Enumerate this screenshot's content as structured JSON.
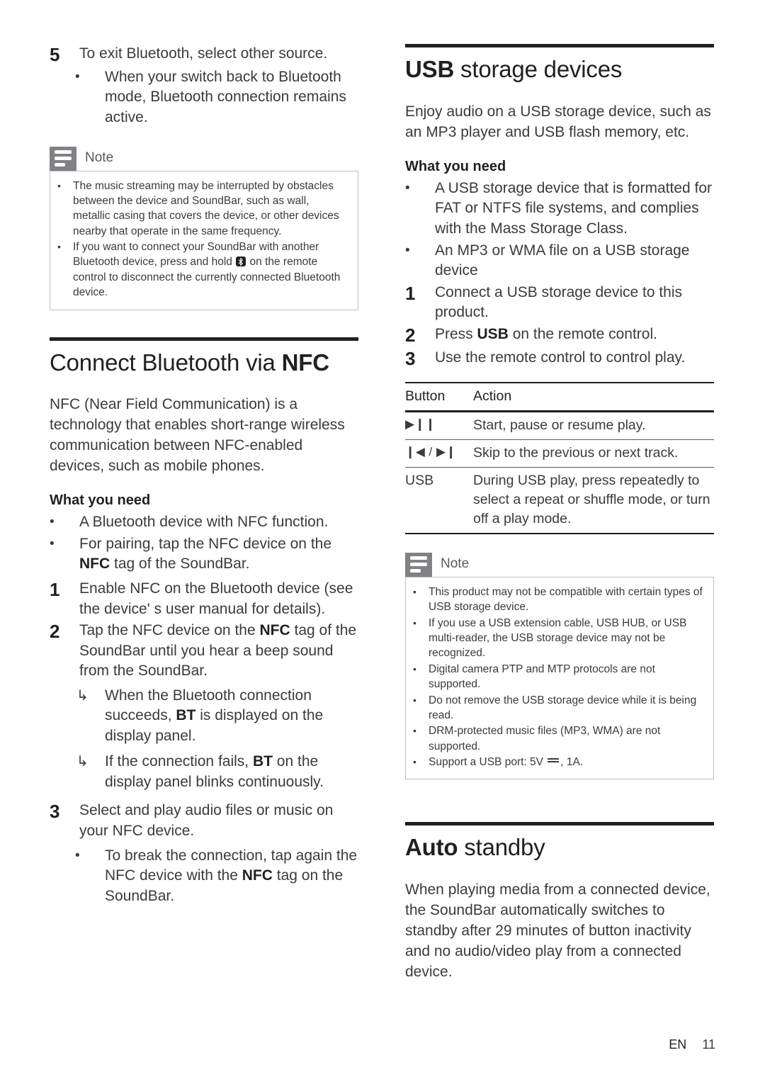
{
  "left_column": {
    "step5": {
      "number": "5",
      "text": "To exit Bluetooth, select other source.",
      "sub_bullets": [
        {
          "marker": "•",
          "text": "When your switch back to Bluetooth mode, Bluetooth connection remains active."
        }
      ]
    },
    "note1": {
      "title": "Note",
      "icon": "note-lines-icon",
      "bullets": [
        {
          "before": "The music streaming may be interrupted by obstacles between the device and SoundBar, such as wall, metallic casing that covers the device, or other devices nearby that operate in the same frequency.",
          "glyph": "",
          "after": ""
        },
        {
          "before": "If you want to connect your SoundBar with another Bluetooth device, press and hold ",
          "glyph": "bluetooth-icon",
          "after": " on the remote control to disconnect the currently connected Bluetooth device."
        }
      ]
    },
    "nfc_section": {
      "heading_light": "Connect Bluetooth via ",
      "heading_bold": "NFC",
      "intro": "NFC (Near Field Communication) is a technology that enables short-range wireless communication between NFC-enabled devices, such as mobile phones.",
      "what_you_need_label": "What you need",
      "requirements": [
        {
          "marker": "•",
          "text": "A Bluetooth device with NFC function."
        },
        {
          "marker": "•",
          "pre": "For pairing, tap the NFC device on the ",
          "bold": "NFC",
          "post": " tag of the SoundBar."
        }
      ],
      "steps": [
        {
          "number": "1",
          "text": "Enable NFC on the Bluetooth device (see the device' s user manual for details)."
        },
        {
          "number": "2",
          "pre": "Tap the NFC device on the ",
          "bold": "NFC",
          "post": " tag of the SoundBar until you hear a beep sound from the SoundBar."
        },
        {
          "number": "3",
          "text": "Select and play audio files or music on your NFC device."
        }
      ],
      "step2_results": [
        {
          "marker": "↳",
          "pre": "When the Bluetooth connection succeeds, ",
          "bold": "BT",
          "post": " is displayed on the display panel."
        },
        {
          "marker": "↳",
          "pre": "If the connection fails, ",
          "bold": "BT",
          "post": " on the display panel blinks continuously."
        }
      ],
      "step3_results": [
        {
          "marker": "•",
          "pre": "To break the connection, tap again the NFC device with the ",
          "bold": "NFC",
          "post": " tag on the SoundBar."
        }
      ]
    }
  },
  "right_column": {
    "usb_section": {
      "heading_bold": "USB",
      "heading_light": " storage devices",
      "intro": "Enjoy audio on a USB storage device, such as an MP3 player and USB flash memory, etc.",
      "what_you_need_label": "What you need",
      "requirements": [
        {
          "marker": "•",
          "text": "A USB storage device that is formatted for FAT or NTFS file systems, and complies with the Mass Storage Class."
        },
        {
          "marker": "•",
          "text": "An MP3 or WMA file on a USB storage device"
        }
      ],
      "steps": [
        {
          "number": "1",
          "text": "Connect a USB storage device to this product."
        },
        {
          "number": "2",
          "pre": "Press ",
          "bold": "USB",
          "post": " on the remote control."
        },
        {
          "number": "3",
          "text": "Use the remote control to control play."
        }
      ],
      "table": {
        "headers": [
          "Button",
          "Action"
        ],
        "rows": [
          {
            "button": "▶❙❙",
            "button_icon": "play-pause-icon",
            "action": "Start, pause or resume play."
          },
          {
            "button": "❙◀ / ▶❙",
            "button_icon": "previous-next-track-icon",
            "action": "Skip to the previous or next track."
          },
          {
            "button": "USB",
            "button_icon": "usb-button",
            "action": "During USB play, press repeatedly to select a repeat or shuffle mode, or turn off a play mode."
          }
        ]
      }
    },
    "note2": {
      "title": "Note",
      "icon": "note-lines-icon",
      "bullets": [
        {
          "before": "This product may not be compatible with certain types of USB storage device.",
          "glyph": "",
          "after": ""
        },
        {
          "before": "If you use a USB extension cable, USB HUB, or USB multi-reader, the USB storage device may not be recognized.",
          "glyph": "",
          "after": ""
        },
        {
          "before": "Digital camera PTP and MTP protocols are not supported.",
          "glyph": "",
          "after": ""
        },
        {
          "before": "Do not remove the USB storage device while it is being read.",
          "glyph": "",
          "after": ""
        },
        {
          "before": "DRM-protected music files (MP3, WMA) are not supported.",
          "glyph": "",
          "after": ""
        },
        {
          "before": "Support a USB port: 5V ",
          "glyph": "dc-power-icon",
          "after": ", 1A."
        }
      ]
    },
    "standby_section": {
      "heading_bold": "Auto",
      "heading_light": " standby",
      "body": "When playing media from a connected device, the SoundBar automatically switches to standby after 29 minutes of button inactivity and no audio/video play from a connected device."
    }
  },
  "footer": {
    "language": "EN",
    "page_number": "11"
  }
}
